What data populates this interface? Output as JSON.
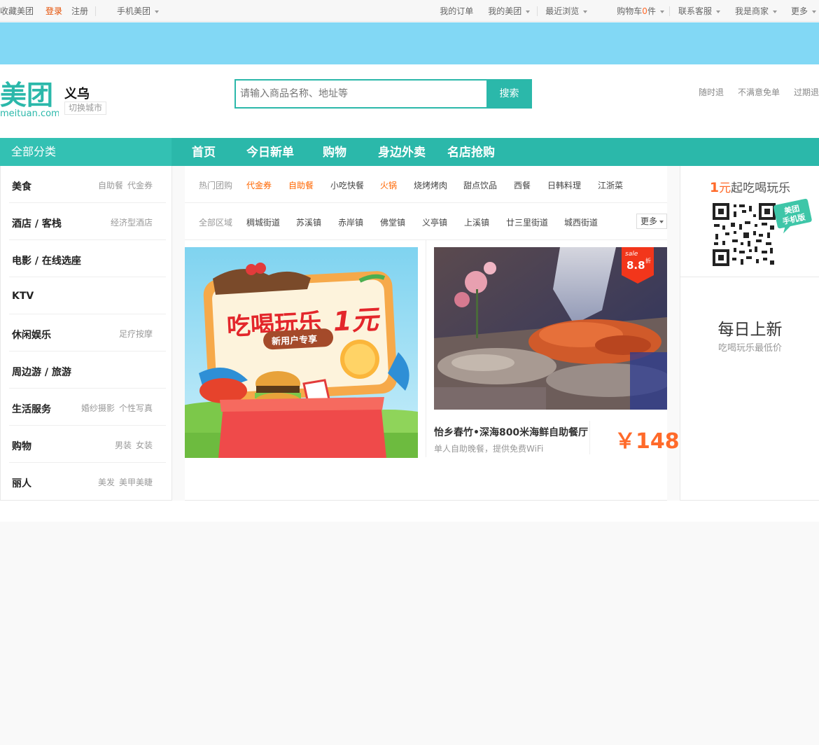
{
  "topbar": {
    "favorite": "收藏美团",
    "login": "登录",
    "register": "注册",
    "mobile": "手机美团",
    "orders": "我的订单",
    "my_meituan": "我的美团",
    "recent": "最近浏览",
    "cart_prefix": "购物车",
    "cart_count": "0",
    "cart_suffix": "件",
    "service": "联系客服",
    "merchant": "我是商家",
    "more": "更多"
  },
  "header": {
    "logo_text": "美团",
    "logo_domain": "meituan.com",
    "city": "义乌",
    "switch_city": "切换城市",
    "search_placeholder": "请输入商品名称、地址等",
    "search_button": "搜索",
    "promises": [
      "随时退",
      "不满意免单",
      "过期退"
    ]
  },
  "nav": {
    "all_categories": "全部分类",
    "items": [
      "首页",
      "今日新单",
      "购物",
      "身边外卖",
      "名店抢购"
    ]
  },
  "categories": [
    {
      "name": "美食",
      "subs": [
        "自助餐",
        "代金券"
      ]
    },
    {
      "name": "酒店 / 客栈",
      "subs": [
        "经济型酒店"
      ]
    },
    {
      "name": "电影 / 在线选座",
      "subs": []
    },
    {
      "name": "KTV",
      "subs": []
    },
    {
      "name": "休闲娱乐",
      "subs": [
        "足疗按摩"
      ]
    },
    {
      "name": "周边游 / 旅游",
      "subs": []
    },
    {
      "name": "生活服务",
      "subs": [
        "婚纱摄影",
        "个性写真"
      ]
    },
    {
      "name": "购物",
      "subs": [
        "男装",
        "女装"
      ]
    },
    {
      "name": "丽人",
      "subs": [
        "美发",
        "美甲美睫"
      ]
    }
  ],
  "filters": {
    "hot_label": "热门团购",
    "hot": [
      {
        "text": "代金券",
        "hot": true
      },
      {
        "text": "自助餐",
        "hot": true
      },
      {
        "text": "小吃快餐",
        "hot": false
      },
      {
        "text": "火锅",
        "hot": true
      },
      {
        "text": "烧烤烤肉",
        "hot": false
      },
      {
        "text": "甜点饮品",
        "hot": false
      },
      {
        "text": "西餐",
        "hot": false
      },
      {
        "text": "日韩料理",
        "hot": false
      },
      {
        "text": "江浙菜",
        "hot": false
      }
    ],
    "area_label": "全部区域",
    "areas": [
      "稠城街道",
      "苏溪镇",
      "赤岸镇",
      "佛堂镇",
      "义亭镇",
      "上溪镇",
      "廿三里街道",
      "城西街道"
    ],
    "more": "更多"
  },
  "promo1": {
    "headline_a": "吃喝玩乐",
    "headline_b": "1元",
    "ribbon": "新用户专享"
  },
  "deal": {
    "badge_word": "sale",
    "badge_discount": "8.8",
    "badge_unit": "折",
    "title": "怡乡春竹•深海800米海鲜自助餐厅",
    "subtitle": "单人自助晚餐，提供免费WiFi",
    "price": "￥148"
  },
  "right": {
    "promo_num": "1",
    "promo_unit": "元",
    "promo_text": "起吃喝玩乐",
    "badge_line1": "美团",
    "badge_line2": "手机版",
    "daily_title": "每日上新",
    "daily_sub": "吃喝玩乐最低价"
  },
  "colors": {
    "brand": "#2bb8aa",
    "accent": "#ff6a2a",
    "banner": "#82d8f5"
  }
}
